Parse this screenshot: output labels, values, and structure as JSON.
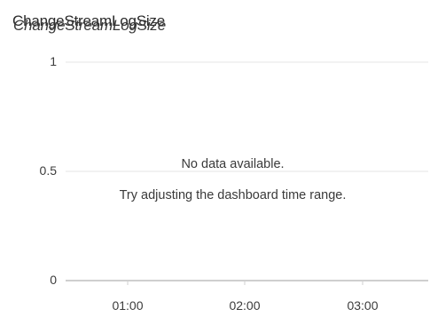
{
  "panel": {
    "title": "ChangeStreamLogSize"
  },
  "chart_data": {
    "type": "line",
    "title": "ChangeStreamLogSize",
    "x_ticks": [
      "01:00",
      "02:00",
      "03:00"
    ],
    "y_ticks": [
      "1",
      "0.5",
      "0"
    ],
    "ylim": [
      0,
      1
    ],
    "grid": true,
    "series": []
  },
  "empty_state": {
    "message": "No data available.",
    "hint": "Try adjusting the dashboard time range."
  },
  "colors": {
    "gridline": "#e6e6e6",
    "baseline": "#cfcfcf",
    "text": "#3c3c3c"
  }
}
